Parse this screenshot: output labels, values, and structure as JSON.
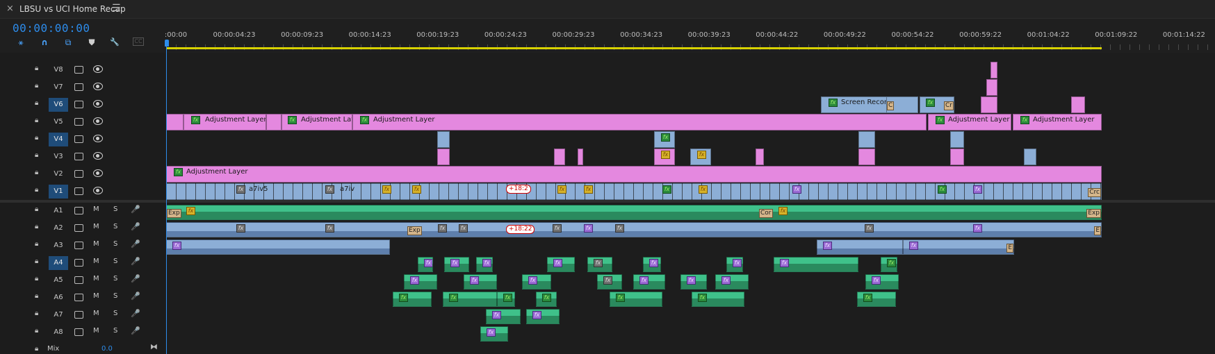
{
  "header": {
    "title": "LBSU vs UCI Home Recap",
    "close_glyph": "×",
    "menu_glyph": "☰"
  },
  "timecode": "00:00:00:00",
  "tools": [
    {
      "name": "snap-icon",
      "glyph": "⚹"
    },
    {
      "name": "linked-selection-icon",
      "glyph": "∩"
    },
    {
      "name": "nest-icon",
      "glyph": "⧉"
    },
    {
      "name": "marker-icon",
      "glyph": "⛊"
    },
    {
      "name": "wrench-icon",
      "glyph": "🔧"
    },
    {
      "name": "captions-icon",
      "glyph": "CC"
    }
  ],
  "ruler": {
    "ticks": [
      ":00:00",
      "00:00:04:23",
      "00:00:09:23",
      "00:00:14:23",
      "00:00:19:23",
      "00:00:24:23",
      "00:00:29:23",
      "00:00:34:23",
      "00:00:39:23",
      "00:00:44:22",
      "00:00:49:22",
      "00:00:54:22",
      "00:00:59:22",
      "00:01:04:22",
      "00:01:09:22",
      "00:01:14:22"
    ]
  },
  "video_tracks": [
    "V8",
    "V7",
    "V6",
    "V5",
    "V4",
    "V3",
    "V2",
    "V1"
  ],
  "audio_tracks": [
    "A1",
    "A2",
    "A3",
    "A4",
    "A5",
    "A6",
    "A7",
    "A8"
  ],
  "active_tracks": [
    "V6",
    "V4",
    "V1",
    "A4"
  ],
  "track_buttons": {
    "mute": "M",
    "solo": "S",
    "mic": "🎤"
  },
  "mix": {
    "label": "Mix",
    "value": "0.0",
    "end_glyph": "⧓"
  },
  "clip_labels": {
    "adjustment_layer": "Adjustment Layer",
    "screen_recording": "Screen Recordi",
    "a7iv5": "a7iv5",
    "a7iv": "a7iv",
    "speed": "+18:2",
    "speed_a2": "+18:22",
    "exp": "Exp",
    "cr": "Cr",
    "crc": "Crc",
    "cor": "Cor",
    "c": "C",
    "e": "E",
    "fx": "fx"
  },
  "colors": {
    "accent": "#2d8ceb",
    "adjustment": "#e488df",
    "video": "#8caed6",
    "audio": "#3fc18a",
    "work_area": "#d8d200"
  }
}
